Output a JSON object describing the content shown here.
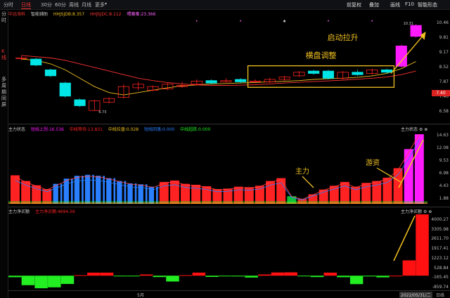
{
  "topbar": {
    "tabs": [
      "分时",
      "日线",
      "30分",
      "60分",
      "周线",
      "月线",
      "更多"
    ],
    "active_tab": "日线",
    "right": [
      "前复权",
      "叠加",
      "画线",
      "F10",
      "智能形态"
    ]
  },
  "left_labels": {
    "top": "分时",
    "k": "K线",
    "side": "多周期同屏"
  },
  "k_header": {
    "stock": "中远海科",
    "assist": "智能辅助",
    "ind1": "HHJSJDB:8.357",
    "ind2": "HHJSJDC:8.112",
    "ind3": "喂魔毒:23.366"
  },
  "k_axis": [
    "10.46",
    "9.81",
    "9.17",
    "8.52",
    "7.87",
    "7.40",
    "6.58"
  ],
  "k_current_price": "7.40",
  "k_low_label": "6.73",
  "k_high_label": "10.31",
  "annotations": {
    "consolidation": "横盘调整",
    "breakout": "启动拉升",
    "main_force": "主力",
    "retail": "游资"
  },
  "sec2_header": {
    "name": "主力状态",
    "i1": "短线上拐:16.536",
    "i2": "中线等待:13.831",
    "i3": "中线拉盘:0.028",
    "i4": "短线回落:0.000",
    "i5": "中线超跌:0.000",
    "right": "主力状态"
  },
  "sec2_axis": [
    "14.63",
    "12.08",
    "9.53",
    "6.98",
    "4.43",
    "1.88"
  ],
  "sec3_header": {
    "name": "主力净买额",
    "i1": "主力净买额:4694.56",
    "right": "主力净买额"
  },
  "sec3_axis": [
    "4000.27",
    "3305.98",
    "2611.70",
    "1917.41",
    "1223.12",
    "528.84",
    "-165.45",
    "-859.74"
  ],
  "date_bar": {
    "month": "5月",
    "date": "2022/05/31/二",
    "period": "日线"
  },
  "colors": {
    "up": "#ff2222",
    "down": "#00e5e5",
    "magenta": "#ff1aff",
    "yellow": "#f0c020",
    "blue": "#2a7fff",
    "green": "#22ee22",
    "dark_green": "#0fbf3a"
  },
  "chart_data": [
    {
      "type": "candlestick",
      "title": "中远海科",
      "ylim": [
        6.58,
        10.46
      ],
      "candles": [
        {
          "o": 8.95,
          "c": 8.95,
          "h": 9.05,
          "l": 8.85
        },
        {
          "o": 8.9,
          "c": 8.65,
          "h": 8.95,
          "l": 8.6
        },
        {
          "o": 8.45,
          "c": 8.2,
          "h": 8.5,
          "l": 8.15
        },
        {
          "o": 7.9,
          "c": 7.35,
          "h": 7.95,
          "l": 7.3
        },
        {
          "o": 7.2,
          "c": 6.95,
          "h": 7.25,
          "l": 6.9
        },
        {
          "o": 6.75,
          "c": 7.15,
          "h": 7.2,
          "l": 6.73
        },
        {
          "o": 7.1,
          "c": 7.25,
          "h": 7.3,
          "l": 7.05
        },
        {
          "o": 7.3,
          "c": 7.75,
          "h": 7.85,
          "l": 7.25
        },
        {
          "o": 7.7,
          "c": 7.85,
          "h": 7.95,
          "l": 7.6
        },
        {
          "o": 7.6,
          "c": 7.75,
          "h": 7.8,
          "l": 7.55
        },
        {
          "o": 7.65,
          "c": 7.85,
          "h": 7.9,
          "l": 7.6
        },
        {
          "o": 7.75,
          "c": 7.8,
          "h": 7.95,
          "l": 7.7
        },
        {
          "o": 7.85,
          "c": 7.98,
          "h": 8.05,
          "l": 7.8
        },
        {
          "o": 8.0,
          "c": 7.9,
          "h": 8.05,
          "l": 7.85
        },
        {
          "o": 7.95,
          "c": 8.0,
          "h": 8.1,
          "l": 7.92
        },
        {
          "o": 8.05,
          "c": 7.95,
          "h": 8.1,
          "l": 7.9
        },
        {
          "o": 7.95,
          "c": 7.98,
          "h": 8.05,
          "l": 7.9
        },
        {
          "o": 7.95,
          "c": 8.05,
          "h": 8.12,
          "l": 7.9
        },
        {
          "o": 8.05,
          "c": 8.15,
          "h": 8.2,
          "l": 8.0
        },
        {
          "o": 8.2,
          "c": 8.35,
          "h": 8.4,
          "l": 8.15
        },
        {
          "o": 8.4,
          "c": 8.3,
          "h": 8.45,
          "l": 8.25
        },
        {
          "o": 8.4,
          "c": 8.1,
          "h": 8.45,
          "l": 8.05
        },
        {
          "o": 8.1,
          "c": 8.35,
          "h": 8.4,
          "l": 8.05
        },
        {
          "o": 8.35,
          "c": 8.25,
          "h": 8.45,
          "l": 8.2
        },
        {
          "o": 8.3,
          "c": 8.45,
          "h": 8.5,
          "l": 8.25
        },
        {
          "o": 8.45,
          "c": 8.35,
          "h": 8.5,
          "l": 8.3
        },
        {
          "o": 8.6,
          "c": 9.45,
          "h": 9.5,
          "l": 8.55
        },
        {
          "o": 9.85,
          "c": 10.31,
          "h": 10.35,
          "l": 9.8
        }
      ],
      "ma": [
        {
          "name": "MA5",
          "color": "#f0c020",
          "values": [
            8.9,
            8.85,
            8.7,
            8.45,
            8.1,
            7.75,
            7.5,
            7.4,
            7.5,
            7.6,
            7.7,
            7.78,
            7.82,
            7.86,
            7.88,
            7.9,
            7.92,
            7.95,
            7.97,
            8.0,
            8.05,
            8.08,
            8.1,
            8.14,
            8.2,
            8.3,
            8.5,
            8.8
          ]
        },
        {
          "name": "MA10",
          "color": "#ff3333",
          "values": [
            9.05,
            9.0,
            8.95,
            8.85,
            8.7,
            8.55,
            8.4,
            8.25,
            8.1,
            8.0,
            7.92,
            7.86,
            7.82,
            7.8,
            7.8,
            7.81,
            7.83,
            7.86,
            7.9,
            7.93,
            7.96,
            7.99,
            8.02,
            8.06,
            8.1,
            8.15,
            8.25,
            8.4
          ]
        }
      ]
    },
    {
      "type": "bar",
      "title": "主力状态",
      "ylim": [
        0,
        14.63
      ],
      "values": [
        6.0,
        4.8,
        3.9,
        3.1,
        4.2,
        5.3,
        5.9,
        6.1,
        5.9,
        5.4,
        4.8,
        4.3,
        4.1,
        3.6,
        4.6,
        4.9,
        4.2,
        4.0,
        3.7,
        3.1,
        3.2,
        3.6,
        3.5,
        3.8,
        4.8,
        5.4,
        1.6,
        1.0,
        2.0,
        3.0,
        3.8,
        4.6,
        3.6,
        4.4,
        4.8,
        5.5,
        7.5,
        11.5,
        16.5
      ],
      "colors": [
        "r",
        "r",
        "r",
        "r",
        "b",
        "b",
        "b",
        "b",
        "b",
        "b",
        "b",
        "b",
        "b",
        "b",
        "r",
        "r",
        "r",
        "r",
        "r",
        "r",
        "r",
        "r",
        "r",
        "r",
        "r",
        "r",
        "g",
        "r",
        "r",
        "r",
        "r",
        "r",
        "r",
        "r",
        "r",
        "r",
        "r",
        "m",
        "m"
      ]
    },
    {
      "type": "bar",
      "title": "主力净买额",
      "ylim": [
        -859.74,
        4000.27
      ],
      "values": [
        -100,
        -620,
        -820,
        -760,
        -540,
        30,
        200,
        200,
        -20,
        -20,
        80,
        -90,
        -380,
        30,
        200,
        -80,
        -40,
        -50,
        -120,
        80,
        210,
        220,
        -40,
        -90,
        200,
        -100,
        -550,
        -50,
        -110,
        1.8,
        1000,
        4694.56
      ]
    }
  ]
}
